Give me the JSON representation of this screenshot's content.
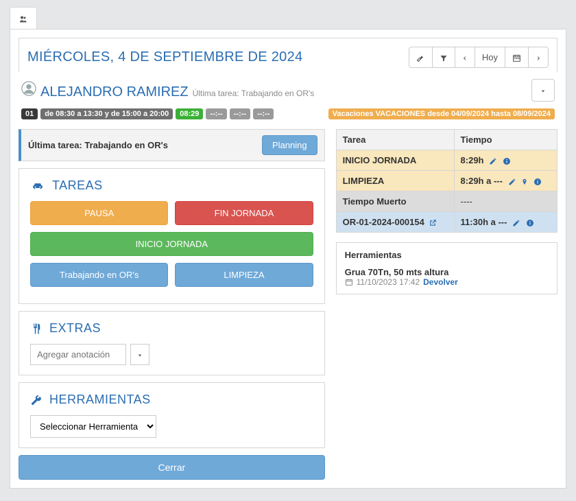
{
  "header": {
    "date_title": "MIÉRCOLES, 4 DE SEPTIEMBRE DE 2024",
    "today_label": "Hoy"
  },
  "person": {
    "name": "ALEJANDRO RAMIREZ",
    "subtitle": "Última tarea: Trabajando en OR's"
  },
  "badges": {
    "num": "01",
    "schedule": "de 08:30 a 13:30 y de 15:00 a 20:00",
    "time_green": "08:29",
    "dash1": "--:--",
    "dash2": "--:--",
    "dash3": "--:--",
    "vacation": "Vacaciones VACACIONES desde 04/09/2024 hasta 08/09/2024"
  },
  "alert": {
    "text": "Última tarea: Trabajando en OR's",
    "planning": "Planning"
  },
  "tareas": {
    "title": "TAREAS",
    "pausa": "PAUSA",
    "fin": "FIN JORNADA",
    "inicio": "INICIO JORNADA",
    "trabajando": "Trabajando en OR's",
    "limpieza": "LIMPIEZA"
  },
  "extras": {
    "title": "EXTRAS",
    "placeholder": "Agregar anotación"
  },
  "herramientas": {
    "title": "HERRAMIENTAS",
    "select_placeholder": "Seleccionar Herramienta"
  },
  "close_label": "Cerrar",
  "table": {
    "h_tarea": "Tarea",
    "h_tiempo": "Tiempo",
    "rows": [
      {
        "tarea": "INICIO JORNADA",
        "tiempo": "8:29h"
      },
      {
        "tarea": "LIMPIEZA",
        "tiempo": "8:29h a ---"
      },
      {
        "tarea": "Tiempo Muerto",
        "tiempo": "----"
      },
      {
        "tarea": "OR-01-2024-000154",
        "tiempo": "11:30h a ---"
      }
    ]
  },
  "tools_panel": {
    "title": "Herramientas",
    "tool_name": "Grua 70Tn, 50 mts altura",
    "tool_date": "11/10/2023 17:42",
    "devolver": "Devolver"
  }
}
